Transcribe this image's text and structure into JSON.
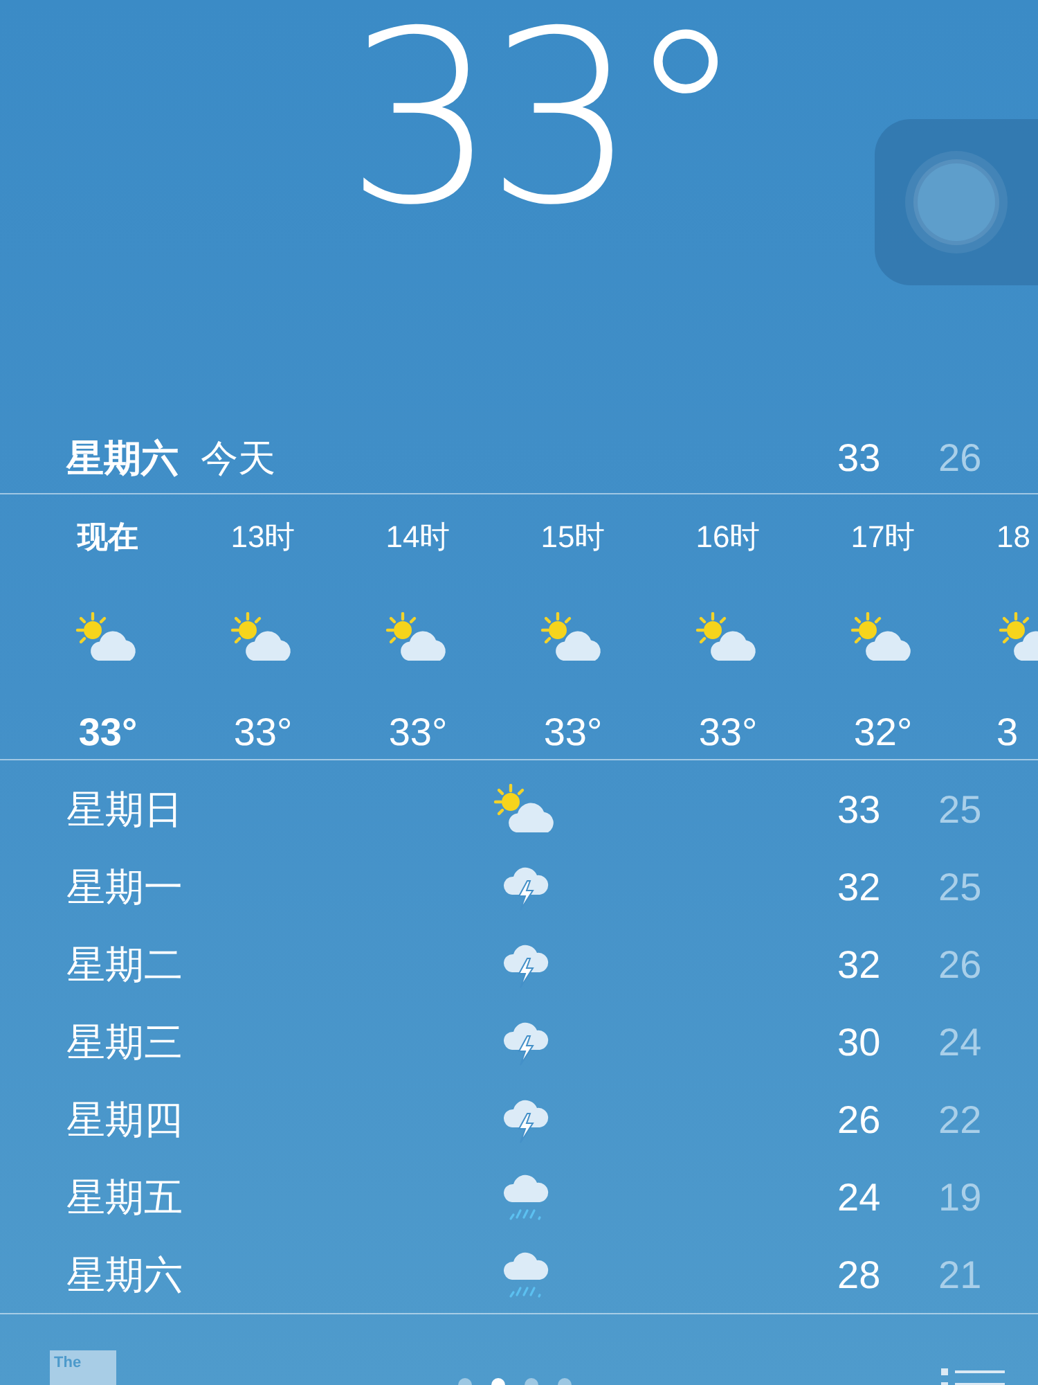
{
  "current": {
    "temperature": "33°"
  },
  "today": {
    "day": "星期六",
    "label": "今天",
    "high": "33",
    "low": "26"
  },
  "hourly": [
    {
      "time": "现在",
      "kind": "partly_cloudy",
      "temp": "33°",
      "current": true
    },
    {
      "time": "13时",
      "kind": "partly_cloudy",
      "temp": "33°",
      "current": false
    },
    {
      "time": "14时",
      "kind": "partly_cloudy",
      "temp": "33°",
      "current": false
    },
    {
      "time": "15时",
      "kind": "partly_cloudy",
      "temp": "33°",
      "current": false
    },
    {
      "time": "16时",
      "kind": "partly_cloudy",
      "temp": "33°",
      "current": false
    },
    {
      "time": "17时",
      "kind": "partly_cloudy",
      "temp": "32°",
      "current": false
    },
    {
      "time": "18",
      "kind": "partly_cloudy",
      "temp": "3",
      "current": false
    }
  ],
  "daily": [
    {
      "day": "星期日",
      "kind": "partly_cloudy",
      "high": "33",
      "low": "25"
    },
    {
      "day": "星期一",
      "kind": "thunderstorm",
      "high": "32",
      "low": "25"
    },
    {
      "day": "星期二",
      "kind": "thunderstorm",
      "high": "32",
      "low": "26"
    },
    {
      "day": "星期三",
      "kind": "thunderstorm",
      "high": "30",
      "low": "24"
    },
    {
      "day": "星期四",
      "kind": "thunderstorm",
      "high": "26",
      "low": "22"
    },
    {
      "day": "星期五",
      "kind": "rain",
      "high": "24",
      "low": "19"
    },
    {
      "day": "星期六",
      "kind": "rain",
      "high": "28",
      "low": "21"
    }
  ],
  "footer": {
    "logo": "The",
    "pages": [
      {
        "selected": false
      },
      {
        "selected": true
      },
      {
        "selected": false
      },
      {
        "selected": false
      }
    ]
  }
}
